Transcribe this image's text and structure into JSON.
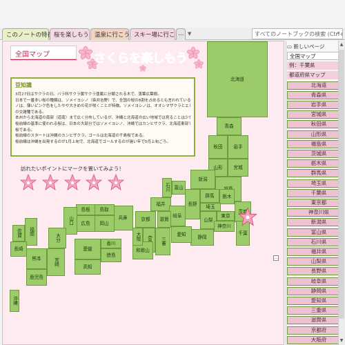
{
  "tabs": [
    {
      "label": "このノートの特長"
    },
    {
      "label": "桜を楽しもう"
    },
    {
      "label": "温泉に行こう"
    },
    {
      "label": "スキー場に行こう"
    },
    {
      "label": "…"
    }
  ],
  "tab_dropdown": "▼",
  "search": {
    "placeholder": "すべてのノートブックの検索 (Ctrl+E)",
    "icon": "search-icon"
  },
  "page": {
    "title": "全国マップ",
    "banner_text": "さくらを楽しもう",
    "info_title": "豆知識",
    "info_lines": [
      "3月27日はサクラの日。バラ科サクラ属サクラ亜属に分類される木で、落葉広葉樹。",
      "日本で一番多い桜の種類は、ソメイヨシノ（染井吉野）で、全国の桜の8割を占めるとも言われている。ソメイヨシ",
      "ノは、薄いピンク色をしたやや大きめの花が咲くことが特徴。ソメイヨシノは、オオシマザクラとエドヒガン",
      "の交雑種である。",
      "本州から北海道の南部（道南）まで広く分布しているが、沖縄と北海道の広い地域では見ることは少ない。",
      "桜前線の基準に使われる桜は、日本の大部分ではソメイヨシノ、沖縄ではカンヒザクラ、北海道東部では千島",
      "桜である。",
      "桜前線のスタートは沖縄のカンヒザクラ。ゴールは北海道の千島桜である。",
      "桜前線は沖縄を出発するのが1月上旬で、北海道でゴールするのが遅い年で5月上旬ごろ。"
    ],
    "stamp_caption": "訪れたいポイントにマークを置いてみよう！",
    "resize_glyph": "…"
  },
  "prefectures": [
    "北海道",
    "青森",
    "秋田",
    "岩手",
    "山形",
    "宮城",
    "新潟",
    "福島",
    "石川",
    "富山",
    "群馬",
    "栃木",
    "茨城",
    "福井",
    "長野",
    "埼玉",
    "千葉",
    "東京",
    "山梨",
    "神奈川",
    "岐阜",
    "静岡",
    "愛知",
    "三重",
    "滋賀",
    "奈良",
    "和歌山",
    "京都",
    "大阪",
    "兵庫",
    "鳥取",
    "島根",
    "岡山",
    "広島",
    "山口",
    "香川",
    "徳島",
    "愛媛",
    "高知",
    "福岡",
    "佐賀",
    "長崎",
    "熊本",
    "大分",
    "宮崎",
    "鹿児島",
    "沖縄"
  ],
  "sidebar": {
    "new_page": "新しいページ",
    "items": [
      {
        "label": "全国マップ",
        "kind": "top"
      },
      {
        "label": "例：千葉県",
        "kind": "sub"
      },
      {
        "label": "都道府県マップ",
        "kind": "sub"
      },
      {
        "label": "北海道",
        "kind": "pref"
      },
      {
        "label": "青森県",
        "kind": "pref"
      },
      {
        "label": "岩手県",
        "kind": "pref"
      },
      {
        "label": "宮城県",
        "kind": "pref"
      },
      {
        "label": "秋田県",
        "kind": "pref"
      },
      {
        "label": "山形県",
        "kind": "pref"
      },
      {
        "label": "福島県",
        "kind": "pref"
      },
      {
        "label": "茨城県",
        "kind": "pref"
      },
      {
        "label": "栃木県",
        "kind": "pref"
      },
      {
        "label": "群馬県",
        "kind": "pref"
      },
      {
        "label": "埼玉県",
        "kind": "pref"
      },
      {
        "label": "千葉県",
        "kind": "pref"
      },
      {
        "label": "東京都",
        "kind": "pref"
      },
      {
        "label": "神奈川県",
        "kind": "pref"
      },
      {
        "label": "新潟県",
        "kind": "pref"
      },
      {
        "label": "富山県",
        "kind": "pref"
      },
      {
        "label": "石川県",
        "kind": "pref"
      },
      {
        "label": "福井県",
        "kind": "pref"
      },
      {
        "label": "山梨県",
        "kind": "pref"
      },
      {
        "label": "長野県",
        "kind": "pref"
      },
      {
        "label": "岐阜県",
        "kind": "pref"
      },
      {
        "label": "静岡県",
        "kind": "pref"
      },
      {
        "label": "愛知県",
        "kind": "pref"
      },
      {
        "label": "三重県",
        "kind": "pref"
      },
      {
        "label": "滋賀県",
        "kind": "pref"
      },
      {
        "label": "京都府",
        "kind": "pref"
      },
      {
        "label": "大阪府",
        "kind": "pref"
      }
    ]
  },
  "scrollbar": {
    "up": "▲",
    "down": "▼"
  },
  "colors": {
    "accent": "#c8234f",
    "map_fill": "#9ccc6a",
    "page_bg": "#fdebf0",
    "sidebar_pref": "#eec3d1"
  }
}
